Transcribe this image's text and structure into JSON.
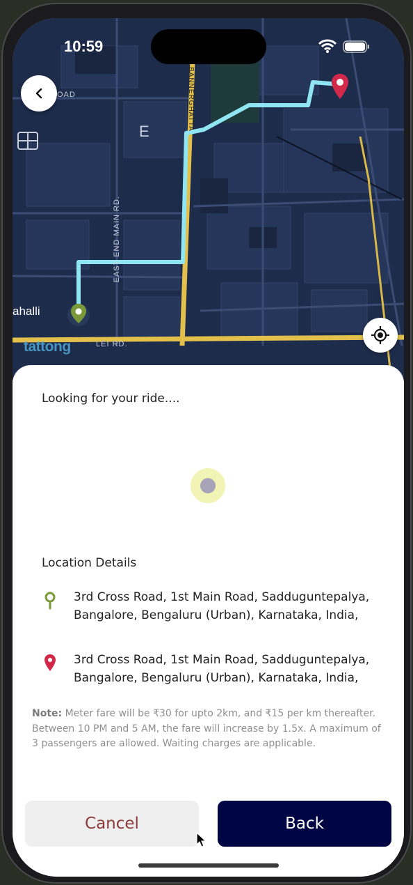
{
  "status_bar": {
    "time": "10:59"
  },
  "map": {
    "labels": {
      "road_top": "H ROAD",
      "road_vertical": "EAST END MAIN RD.",
      "road_vertical_right": "BANNERGHATTA",
      "road_bottom": "LEI RD.",
      "area": "ahalli",
      "block": "E"
    },
    "brand": "tattong",
    "route_color": "#8fe6f2",
    "pickup_color": "#7a9a3a",
    "drop_color": "#d2284a"
  },
  "sheet": {
    "status_text": "Looking for your ride....",
    "location_title": "Location Details",
    "pickup_address": "3rd Cross Road, 1st Main Road, Sadduguntepalya, Bangalore, Bengaluru (Urban), Karnataka, India,",
    "drop_address": "3rd Cross Road, 1st Main Road, Sadduguntepalya, Bangalore, Bengaluru (Urban), Karnataka, India,",
    "note_label": "Note:",
    "note_text": " Meter fare will be ₹30 for upto 2km, and ₹15 per km thereafter. Between 10 PM and 5 AM, the fare will increase by 1.5x. A maximum of 3 passengers are allowed. Waiting charges are applicable."
  },
  "buttons": {
    "cancel_label": "Cancel",
    "back_label": "Back"
  },
  "colors": {
    "accent_dark": "#000544",
    "cancel_text": "#8c3b3b",
    "pulse_outer": "#f1f4b4",
    "pulse_inner": "#a7a3b8"
  }
}
